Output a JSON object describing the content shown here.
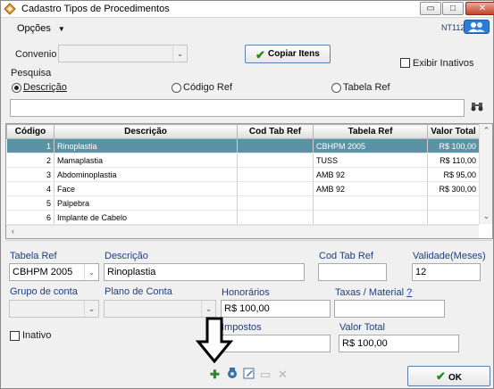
{
  "window": {
    "title": "Cadastro Tipos de Procedimentos",
    "minimize_glyph": "▭",
    "maximize_glyph": "□",
    "close_glyph": "✕"
  },
  "menu": {
    "opcoes_label": "Opções",
    "nt_label": "NT112"
  },
  "convenio": {
    "label": "Convenio",
    "value": ""
  },
  "copy_button": {
    "label": "Copiar Itens"
  },
  "exibir_inativos": {
    "label": "Exibir Inativos",
    "checked": false
  },
  "pesquisa": {
    "label": "Pesquisa",
    "options": [
      {
        "label": "Descrição",
        "checked": true
      },
      {
        "label": "Código Ref",
        "checked": false
      },
      {
        "label": "Tabela Ref",
        "checked": false
      }
    ],
    "search_value": ""
  },
  "table": {
    "columns": [
      "Código",
      "Descrição",
      "Cod Tab Ref",
      "Tabela Ref",
      "Valor Total"
    ],
    "rows": [
      {
        "codigo": "1",
        "descricao": "Rinoplastia",
        "cod_tab_ref": "",
        "tabela_ref": "CBHPM 2005",
        "valor_total": "R$ 100,00",
        "selected": true
      },
      {
        "codigo": "2",
        "descricao": "Mamaplastia",
        "cod_tab_ref": "",
        "tabela_ref": "TUSS",
        "valor_total": "R$ 110,00",
        "selected": false
      },
      {
        "codigo": "3",
        "descricao": "Abdominoplastia",
        "cod_tab_ref": "",
        "tabela_ref": "AMB 92",
        "valor_total": "R$ 95,00",
        "selected": false
      },
      {
        "codigo": "4",
        "descricao": "Face",
        "cod_tab_ref": "",
        "tabela_ref": "AMB 92",
        "valor_total": "R$ 300,00",
        "selected": false
      },
      {
        "codigo": "5",
        "descricao": "Palpebra",
        "cod_tab_ref": "",
        "tabela_ref": "",
        "valor_total": "",
        "selected": false
      },
      {
        "codigo": "6",
        "descricao": "Implante de Cabelo",
        "cod_tab_ref": "",
        "tabela_ref": "",
        "valor_total": "",
        "selected": false
      }
    ]
  },
  "form": {
    "tabela_ref": {
      "label": "Tabela Ref",
      "value": "CBHPM 2005"
    },
    "descricao": {
      "label": "Descrição",
      "value": "Rinoplastia"
    },
    "cod_tab_ref": {
      "label": "Cod Tab Ref",
      "value": ""
    },
    "validade": {
      "label": "Validade(Meses)",
      "value": "12"
    },
    "grupo_conta": {
      "label": "Grupo de conta",
      "value": ""
    },
    "plano_conta": {
      "label": "Plano de Conta",
      "value": ""
    },
    "honorarios": {
      "label": "Honorários",
      "value": "R$ 100,00"
    },
    "taxas": {
      "label": "Taxas / Material",
      "help": "?",
      "value": ""
    },
    "inativo": {
      "label": "Inativo",
      "checked": false
    },
    "impostos": {
      "label": "Impostos",
      "value": ""
    },
    "valor_total": {
      "label": "Valor Total",
      "value": "R$ 100,00"
    }
  },
  "toolbar": {
    "icons": [
      "add-icon",
      "camera-icon",
      "edit-icon",
      "save-icon",
      "delete-icon"
    ]
  },
  "ok_button": {
    "label": "OK"
  },
  "colors": {
    "selected_row": "#5b93a5",
    "button_border": "#5a7fb0",
    "check_green": "#1c8a1c"
  }
}
